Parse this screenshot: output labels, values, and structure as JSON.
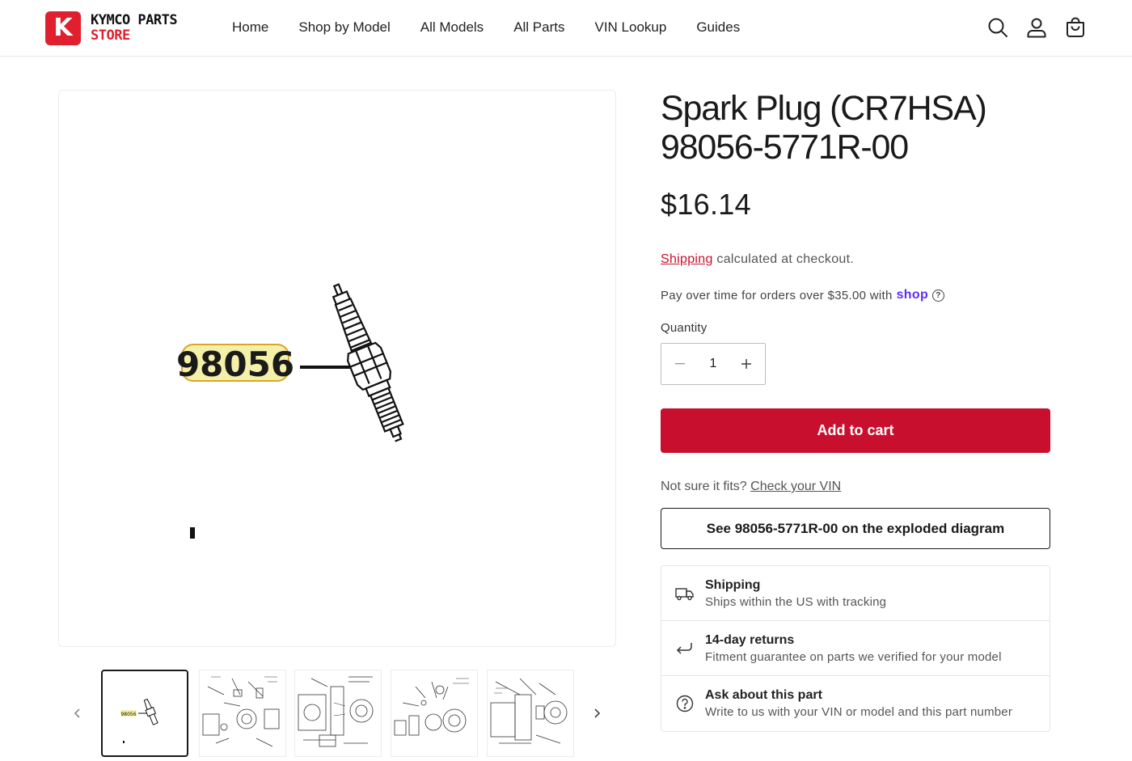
{
  "brand": {
    "badge_letter": "K",
    "line1": "KYMCO PARTS",
    "line2": "STORE",
    "accent_color": "#e0202e"
  },
  "nav": {
    "items": [
      "Home",
      "Shop by Model",
      "All Models",
      "All Parts",
      "VIN Lookup",
      "Guides"
    ]
  },
  "header_icons": [
    "search-icon",
    "account-icon",
    "cart-icon"
  ],
  "gallery": {
    "callout_number": "98056",
    "thumb_callout": "98056"
  },
  "product": {
    "title_line1": "Spark Plug (CR7HSA)",
    "title_line2": "98056-5771R-00",
    "price": "$16.14",
    "shipping_link": "Shipping",
    "shipping_text": " calculated at checkout.",
    "payover_text": "Pay over time for orders over $35.00 with",
    "shop_word": "shop",
    "quantity_label": "Quantity",
    "quantity_value": "1",
    "add_to_cart": "Add to cart",
    "notsure_text": "Not sure it fits? ",
    "check_vin": "Check your VIN",
    "diagram_button": "See 98056-5771R-00 on the exploded diagram",
    "primary_color": "#c8102e"
  },
  "features": [
    {
      "icon": "truck-icon",
      "title": "Shipping",
      "desc": "Ships within the US with tracking"
    },
    {
      "icon": "return-arrow-icon",
      "title": "14-day returns",
      "desc": "Fitment guarantee on parts we verified for your model"
    },
    {
      "icon": "question-icon",
      "title": "Ask about this part",
      "desc": "Write to us with your VIN or model and this part number"
    }
  ]
}
